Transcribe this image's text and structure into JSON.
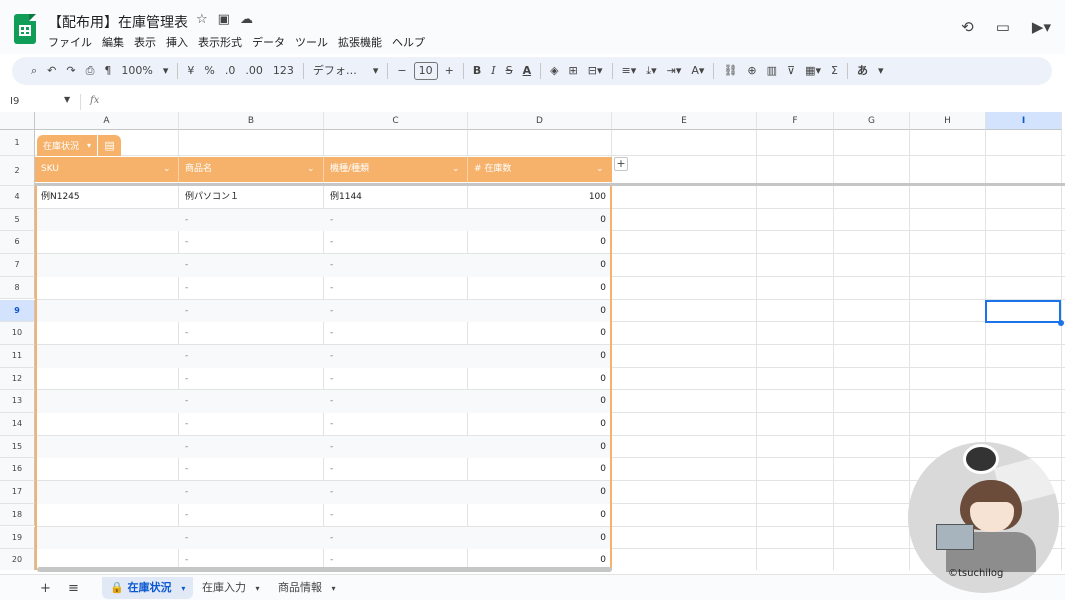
{
  "app": {
    "title": "【配布用】在庫管理表",
    "menus": [
      "ファイル",
      "編集",
      "表示",
      "挿入",
      "表示形式",
      "データ",
      "ツール",
      "拡張機能",
      "ヘルプ"
    ]
  },
  "toolbar": {
    "zoom": "100%",
    "currency": "¥",
    "percent": "%",
    "dec_decrease": ".0",
    "dec_increase": ".00",
    "number_format": "123",
    "font": "デフォ…",
    "font_size": "10",
    "bold": "B",
    "italic": "I",
    "strike": "S",
    "text_color": "A",
    "sum": "Σ",
    "input_tool": "あ"
  },
  "formula_bar": {
    "namebox": "I9",
    "fx": "fx",
    "value": ""
  },
  "columns": [
    "A",
    "B",
    "C",
    "D",
    "E",
    "F",
    "G",
    "H",
    "I"
  ],
  "selected_column": "I",
  "row_numbers": [
    "1",
    "2",
    "4",
    "5",
    "6",
    "7",
    "8",
    "9",
    "10",
    "11",
    "12",
    "13",
    "14",
    "15",
    "16",
    "17",
    "18",
    "19",
    "20"
  ],
  "selected_row": "9",
  "table": {
    "name": "在庫状況",
    "header_color": "#f6b26b",
    "headers": [
      "SKU",
      "商品名",
      "機種/種類",
      "# 在庫数"
    ],
    "rows": [
      [
        "例N1245",
        "例パソコン１",
        "例1144",
        "100"
      ],
      [
        "",
        "-",
        "-",
        "0"
      ],
      [
        "",
        "-",
        "-",
        "0"
      ],
      [
        "",
        "-",
        "-",
        "0"
      ],
      [
        "",
        "-",
        "-",
        "0"
      ],
      [
        "",
        "-",
        "-",
        "0"
      ],
      [
        "",
        "-",
        "-",
        "0"
      ],
      [
        "",
        "-",
        "-",
        "0"
      ],
      [
        "",
        "-",
        "-",
        "0"
      ],
      [
        "",
        "-",
        "-",
        "0"
      ],
      [
        "",
        "-",
        "-",
        "0"
      ],
      [
        "",
        "-",
        "-",
        "0"
      ],
      [
        "",
        "-",
        "-",
        "0"
      ],
      [
        "",
        "-",
        "-",
        "0"
      ],
      [
        "",
        "-",
        "-",
        "0"
      ],
      [
        "",
        "-",
        "-",
        "0"
      ],
      [
        "",
        "-",
        "-",
        "0"
      ]
    ]
  },
  "sheet_tabs": [
    {
      "label": "在庫状況",
      "active": true,
      "locked": true
    },
    {
      "label": "在庫入力",
      "active": false,
      "locked": false
    },
    {
      "label": "商品情報",
      "active": false,
      "locked": false
    }
  ],
  "watermark": "©tsuchilog"
}
